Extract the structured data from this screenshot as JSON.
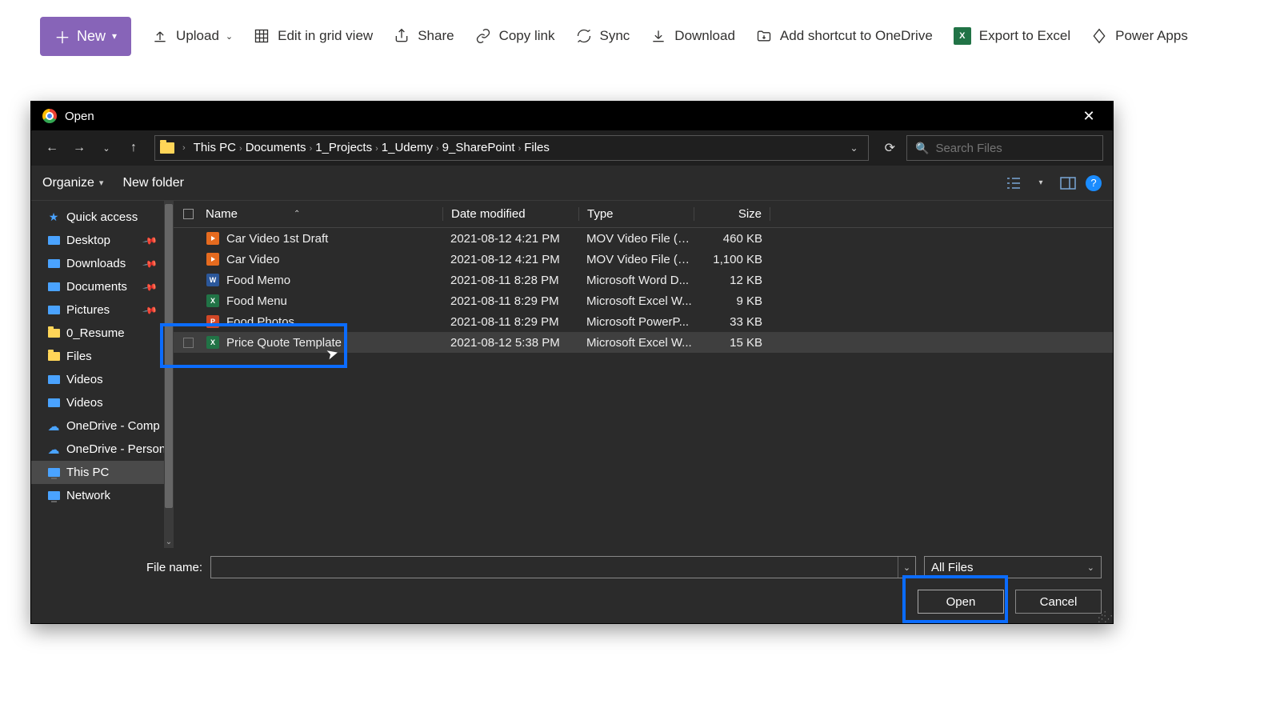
{
  "toolbar": {
    "new_label": "New",
    "upload_label": "Upload",
    "edit_grid_label": "Edit in grid view",
    "share_label": "Share",
    "copy_link_label": "Copy link",
    "sync_label": "Sync",
    "download_label": "Download",
    "add_shortcut_label": "Add shortcut to OneDrive",
    "export_excel_label": "Export to Excel",
    "power_apps_label": "Power Apps"
  },
  "dialog": {
    "title": "Open",
    "breadcrumbs": [
      "This PC",
      "Documents",
      "1_Projects",
      "1_Udemy",
      "9_SharePoint",
      "Files"
    ],
    "search_placeholder": "Search Files",
    "organize_label": "Organize",
    "new_folder_label": "New folder",
    "columns": {
      "name": "Name",
      "date": "Date modified",
      "type": "Type",
      "size": "Size"
    },
    "file_name_label": "File name:",
    "filter_label": "All Files",
    "open_label": "Open",
    "cancel_label": "Cancel"
  },
  "sidebar": [
    {
      "label": "Quick access",
      "icon": "star"
    },
    {
      "label": "Desktop",
      "icon": "blue",
      "pinned": true
    },
    {
      "label": "Downloads",
      "icon": "blue",
      "pinned": true
    },
    {
      "label": "Documents",
      "icon": "doc",
      "pinned": true
    },
    {
      "label": "Pictures",
      "icon": "blue",
      "pinned": true
    },
    {
      "label": "0_Resume",
      "icon": "folder"
    },
    {
      "label": "Files",
      "icon": "folder"
    },
    {
      "label": "Videos",
      "icon": "video"
    },
    {
      "label": "Videos",
      "icon": "video2"
    },
    {
      "label": "OneDrive - Comp",
      "icon": "cloud"
    },
    {
      "label": "OneDrive - Person",
      "icon": "cloud"
    },
    {
      "label": "This PC",
      "icon": "pc",
      "selected": true
    },
    {
      "label": "Network",
      "icon": "net"
    }
  ],
  "files": [
    {
      "name": "Car Video 1st Draft",
      "date": "2021-08-12 4:21 PM",
      "type": "MOV Video File (V...",
      "size": "460 KB",
      "icon": "mov"
    },
    {
      "name": "Car Video",
      "date": "2021-08-12 4:21 PM",
      "type": "MOV Video File (V...",
      "size": "1,100 KB",
      "icon": "mov"
    },
    {
      "name": "Food Memo",
      "date": "2021-08-11 8:28 PM",
      "type": "Microsoft Word D...",
      "size": "12 KB",
      "icon": "word"
    },
    {
      "name": "Food Menu",
      "date": "2021-08-11 8:29 PM",
      "type": "Microsoft Excel W...",
      "size": "9 KB",
      "icon": "excel"
    },
    {
      "name": "Food Photos",
      "date": "2021-08-11 8:29 PM",
      "type": "Microsoft PowerP...",
      "size": "33 KB",
      "icon": "ppt"
    },
    {
      "name": "Price Quote Template",
      "date": "2021-08-12 5:38 PM",
      "type": "Microsoft Excel W...",
      "size": "15 KB",
      "icon": "excel",
      "selected": true
    }
  ]
}
